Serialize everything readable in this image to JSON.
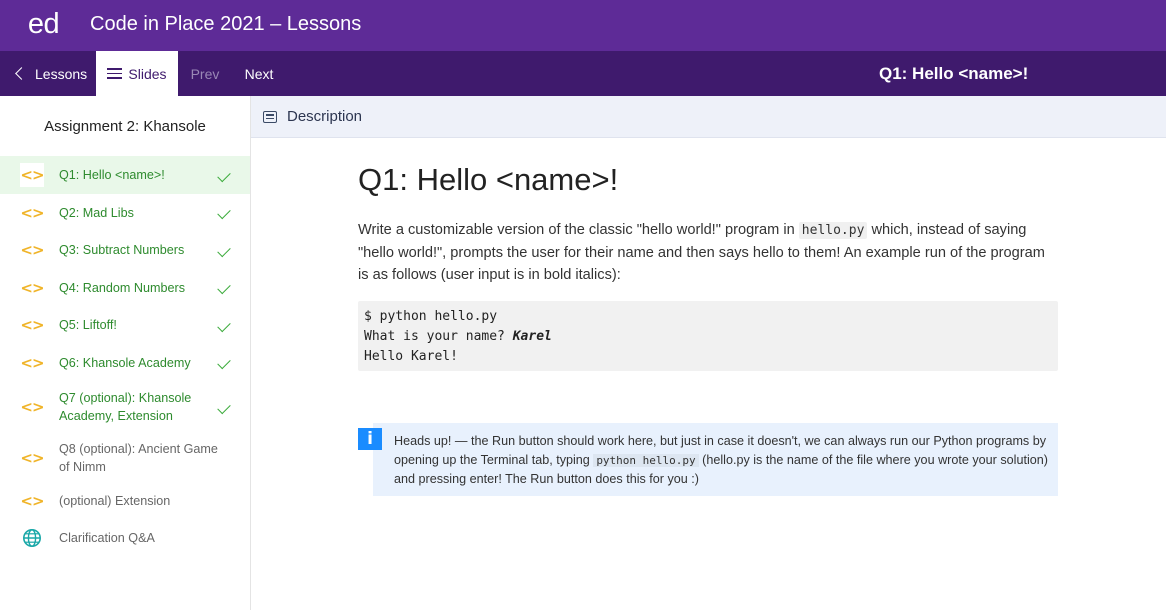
{
  "app": {
    "logo": "ed",
    "title": "Code in Place 2021 – Lessons"
  },
  "nav": {
    "lessons_label": "Lessons",
    "slides_label": "Slides",
    "prev_label": "Prev",
    "next_label": "Next",
    "current_lesson_title": "Q1: Hello <name>!"
  },
  "sidebar": {
    "heading": "Assignment 2: Khansole",
    "items": [
      {
        "label": "Q1: Hello <name>!",
        "icon": "code-icon",
        "completed": true,
        "active": true
      },
      {
        "label": "Q2: Mad Libs",
        "icon": "code-icon",
        "completed": true,
        "active": false
      },
      {
        "label": "Q3: Subtract Numbers",
        "icon": "code-icon",
        "completed": true,
        "active": false
      },
      {
        "label": "Q4: Random Numbers",
        "icon": "code-icon",
        "completed": true,
        "active": false
      },
      {
        "label": "Q5: Liftoff!",
        "icon": "code-icon",
        "completed": true,
        "active": false
      },
      {
        "label": "Q6: Khansole Academy",
        "icon": "code-icon",
        "completed": true,
        "active": false
      },
      {
        "label": "Q7 (optional): Khansole Academy, Extension",
        "icon": "code-icon",
        "completed": true,
        "active": false
      },
      {
        "label": "Q8 (optional): Ancient Game of Nimm",
        "icon": "code-icon",
        "completed": false,
        "active": false
      },
      {
        "label": "(optional) Extension",
        "icon": "code-icon",
        "completed": false,
        "active": false
      },
      {
        "label": "Clarification Q&A",
        "icon": "globe-icon",
        "completed": false,
        "active": false
      }
    ]
  },
  "description_tab": {
    "label": "Description",
    "icon": "description-icon"
  },
  "main": {
    "title": "Q1: Hello <name>!",
    "para_part1": "Write a customizable version of the classic \"hello world!\" program in ",
    "para_code": "hello.py",
    "para_part2": " which, instead of saying \"hello world!\", prompts the user for their name and then says hello to them! An example run of the program is as follows (user input is in bold italics):",
    "code_line1": "$ python hello.py",
    "code_line2_prefix": "What is your name? ",
    "code_line2_input": "Karel",
    "code_line3": "Hello Karel!"
  },
  "callout": {
    "icon": "info-icon",
    "icon_glyph": "i",
    "text_part1": "Heads up! — the Run button should work here, but just in case it doesn't, we can always run our Python programs by opening up the Terminal tab, typing ",
    "code": "python hello.py",
    "text_part2": " (hello.py is the name of the file where you wrote your solution) and pressing enter! The Run button does this for you :)"
  },
  "colors": {
    "topbar": "#5e2b97",
    "navbar": "#3f1a6d",
    "completed_green": "#2e8b2e",
    "code_icon_yellow": "#f0b429",
    "info_blue": "#1a8cff"
  }
}
